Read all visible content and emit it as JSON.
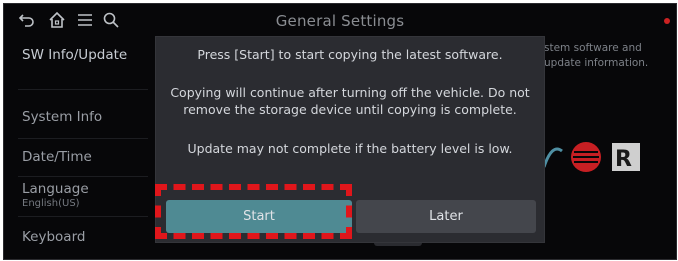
{
  "header": {
    "title": "General Settings"
  },
  "icons": {
    "back": "back-arrow-icon",
    "home": "home-icon",
    "menu": "menu-icon",
    "search": "search-icon"
  },
  "sidebar": {
    "items": [
      {
        "label": "SW Info/Update"
      },
      {
        "label": "System Info"
      },
      {
        "label": "Date/Time"
      },
      {
        "label": "Language",
        "sub": "English(US)"
      },
      {
        "label": "Keyboard"
      }
    ]
  },
  "right_panel": {
    "text": "stem software and update information."
  },
  "dialog": {
    "line1": "Press [Start] to start copying the latest software.",
    "line2a": "Copying will continue after turning off the vehicle. Do not",
    "line2b": "remove the storage device until copying is complete.",
    "line3": "Update may not complete if the battery level is low.",
    "start_label": "Start",
    "later_label": "Later"
  },
  "colors": {
    "accent": "#4f8a93",
    "highlight": "#e0161b",
    "background": "#070709"
  }
}
